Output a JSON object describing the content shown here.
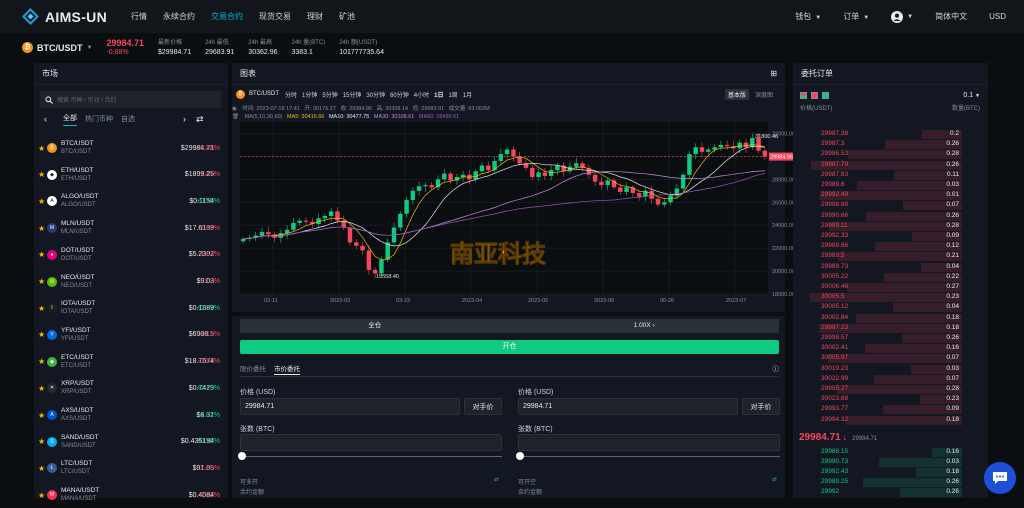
{
  "nav": {
    "brand": "AIMS-UN",
    "links": [
      "行情",
      "永续合约",
      "交易合约",
      "现货交易",
      "理财",
      "矿池"
    ],
    "active_index": 2,
    "right": {
      "wallet": "钱包",
      "orders": "订单",
      "lang": "简体中文",
      "currency": "USD"
    }
  },
  "ticker": {
    "pair": "BTC/USDT",
    "price": "29984.71",
    "change": "-0.88%",
    "stats": [
      {
        "label": "最新价格",
        "value": "$29984.71"
      },
      {
        "label": "24h 最低",
        "value": "29683.91"
      },
      {
        "label": "24h 最高",
        "value": "30362.96"
      },
      {
        "label": "24h 量(BTC)",
        "value": "3383.1"
      },
      {
        "label": "24h 额(USDT)",
        "value": "101777735.64"
      }
    ]
  },
  "market": {
    "title": "市场",
    "search_placeholder": "搜索 币种 / 币对 / 合约",
    "tabs": [
      "全部",
      "热门币种",
      "自选"
    ],
    "rows": [
      {
        "name": "BTC/USDT",
        "sub": "BTC/USDT",
        "price": "$29984.71",
        "change": "-0.88%",
        "dir": "dn",
        "color": "#f7931a",
        "glyph": "₿"
      },
      {
        "name": "ETH/USDT",
        "sub": "ETH/USDT",
        "price": "$1899.25",
        "change": "-1.47%",
        "dir": "dn",
        "color": "#ffffff",
        "glyph": "◆"
      },
      {
        "name": "ALGO/USDT",
        "sub": "ALGO/USDT",
        "price": "$0.1154",
        "change": "+0.35%",
        "dir": "up",
        "color": "#ffffff",
        "glyph": "A"
      },
      {
        "name": "MLN/USDT",
        "sub": "MLN/USDT",
        "price": "$17.6139",
        "change": "-1.65%",
        "dir": "dn",
        "color": "#2a3a7a",
        "glyph": "M"
      },
      {
        "name": "DOT/USDT",
        "sub": "DOT/USDT",
        "price": "$5.2302",
        "change": "-1.53%",
        "dir": "dn",
        "color": "#e6007a",
        "glyph": "●"
      },
      {
        "name": "NEO/USDT",
        "sub": "NEO/USDT",
        "price": "$9.03",
        "change": "-1.2%",
        "dir": "dn",
        "color": "#58bf00",
        "glyph": "N"
      },
      {
        "name": "IOTA/USDT",
        "sub": "IOTA/USDT",
        "price": "$0.1889",
        "change": "+0.27%",
        "dir": "up",
        "color": "#1e1e1e",
        "glyph": "I"
      },
      {
        "name": "YFI/USDT",
        "sub": "YFI/USDT",
        "price": "$6908.5",
        "change": "-1.15%",
        "dir": "dn",
        "color": "#006ae3",
        "glyph": "Y"
      },
      {
        "name": "ETC/USDT",
        "sub": "ETC/USDT",
        "price": "$18.7674",
        "change": "-0.57%",
        "dir": "dn",
        "color": "#3ab83a",
        "glyph": "◆"
      },
      {
        "name": "XRP/USDT",
        "sub": "XRP/USDT",
        "price": "$0.7429",
        "change": "+0.19%",
        "dir": "up",
        "color": "#23292f",
        "glyph": "✕"
      },
      {
        "name": "AXS/USDT",
        "sub": "AXS/USDT",
        "price": "$6.31",
        "change": "+1.02%",
        "dir": "up",
        "color": "#0055d5",
        "glyph": "A"
      },
      {
        "name": "SAND/USDT",
        "sub": "SAND/USDT",
        "price": "$0.435194",
        "change": "+0.15%",
        "dir": "up",
        "color": "#04adef",
        "glyph": "S"
      },
      {
        "name": "LTC/USDT",
        "sub": "LTC/USDT",
        "price": "$91.05",
        "change": "-2.85%",
        "dir": "dn",
        "color": "#345d9d",
        "glyph": "Ł"
      },
      {
        "name": "MANA/USDT",
        "sub": "MANA/USDT",
        "price": "$0.4084",
        "change": "-0.12%",
        "dir": "dn",
        "color": "#ff2d55",
        "glyph": "M"
      }
    ]
  },
  "chart": {
    "title": "图表",
    "pair": "BTC/USDT",
    "intervals": [
      "分时",
      "1分钟",
      "5分钟",
      "15分钟",
      "30分钟",
      "60分钟",
      "4小时",
      "1日",
      "1周",
      "1月"
    ],
    "active_interval": "1日",
    "view_basic": "基本版",
    "view_depth": "深度图",
    "info": {
      "time": "时间: 2023-07-18 17:41",
      "open": "开: 30176.27",
      "close": "收: 29984.96",
      "high": "高: 30309.14",
      "low": "低: 29683.91",
      "vol": "成交量: 63.002M"
    },
    "ma": {
      "ma": "MA(5,10,30,60)",
      "ma5": "MA5: 30416.66",
      "ma10": "MA10: 30477.75",
      "ma30": "MA30: 30108.61",
      "ma60": "MA60: 28499.61"
    },
    "yticks": [
      "32000.00",
      "30000.00",
      "28000.00",
      "26000.00",
      "24000.00",
      "22000.00",
      "20000.00",
      "18000.00"
    ],
    "xticks": [
      "02-11",
      "2023-03",
      "03-23",
      "2023-04",
      "2023-05",
      "2023-06",
      "06-26",
      "2023-07"
    ],
    "high_label": "31800.46",
    "low_label": "19558.40",
    "last_price": "29984.96",
    "watermark": "南亚科技"
  },
  "chart_data": {
    "type": "candlestick",
    "ylim": [
      18000,
      33000
    ],
    "last": 29984.96,
    "high": 31800.46,
    "low": 19558.4,
    "series_close": [
      22800,
      22900,
      23100,
      23400,
      23200,
      22900,
      23300,
      23600,
      24200,
      24400,
      24300,
      24100,
      24600,
      24800,
      25200,
      24400,
      23800,
      22500,
      22200,
      21800,
      20100,
      19800,
      21000,
      22500,
      23800,
      25000,
      26200,
      27000,
      27400,
      27500,
      27300,
      28000,
      28500,
      27900,
      28200,
      28400,
      28000,
      28700,
      29200,
      28800,
      29600,
      30200,
      30600,
      30000,
      29400,
      29000,
      28200,
      28600,
      28300,
      28800,
      29200,
      28700,
      29100,
      29400,
      29000,
      28400,
      27800,
      27500,
      27900,
      27300,
      26900,
      27300,
      26800,
      26500,
      27000,
      26300,
      25800,
      26000,
      26600,
      27200,
      28400,
      30200,
      30800,
      30400,
      30600,
      30800,
      31000,
      30900,
      30700,
      31200,
      30800,
      31600,
      30500,
      29985
    ]
  },
  "orderbook": {
    "title": "委托订单",
    "precision": "0.1",
    "col_price": "价格(USDT)",
    "col_qty": "数量(BTC)",
    "asks": [
      [
        "29987.38",
        "0.2"
      ],
      [
        "29987.3",
        "0.26"
      ],
      [
        "29986.53",
        "0.28"
      ],
      [
        "29987.79",
        "0.26"
      ],
      [
        "29987.83",
        "0.11"
      ],
      [
        "29989.6",
        "0.03"
      ],
      [
        "29992.49",
        "0.01"
      ],
      [
        "29998.88",
        "0.07"
      ],
      [
        "29990.66",
        "0.26"
      ],
      [
        "29989.11",
        "0.28"
      ],
      [
        "29992.33",
        "0.09"
      ],
      [
        "29989.86",
        "0.12"
      ],
      [
        "29989.5",
        "0.21"
      ],
      [
        "29989.73",
        "0.04"
      ],
      [
        "30005.22",
        "0.22"
      ],
      [
        "30006.46",
        "0.27"
      ],
      [
        "30005.5",
        "0.23"
      ],
      [
        "30005.12",
        "0.04"
      ],
      [
        "30002.84",
        "0.18"
      ],
      [
        "29997.23",
        "0.18"
      ],
      [
        "29998.57",
        "0.26"
      ],
      [
        "30002.41",
        "0.16"
      ],
      [
        "30005.97",
        "0.07"
      ],
      [
        "30019.23",
        "0.03"
      ],
      [
        "30022.99",
        "0.07"
      ],
      [
        "29995.27",
        "0.28"
      ],
      [
        "30023.68",
        "0.23"
      ],
      [
        "29993.77",
        "0.09"
      ],
      [
        "29994.32",
        "0.18"
      ]
    ],
    "last": "29984.71",
    "last_sub": "29984.71",
    "bids": [
      [
        "29988.15",
        "0.16"
      ],
      [
        "29990.73",
        "0.03"
      ],
      [
        "29992.43",
        "0.18"
      ],
      [
        "29989.25",
        "0.26"
      ],
      [
        "29992",
        "0.26"
      ]
    ]
  },
  "trade": {
    "margin_mode": "全仓",
    "leverage": "1.00X",
    "open_btn": "开仓",
    "tabs": [
      "限价委托",
      "市价委托"
    ],
    "left": {
      "price_label": "价格 (USD)",
      "price": "29984.71",
      "counter_btn": "对手价",
      "qty_label": "张数 (BTC)",
      "can_open": "可多开",
      "available": "余约金额"
    },
    "right": {
      "price_label": "价格 (USD)",
      "price": "29984.71",
      "counter_btn": "对手价",
      "qty_label": "张数 (BTC)",
      "can_open": "可开空",
      "available": "余约金额"
    }
  }
}
